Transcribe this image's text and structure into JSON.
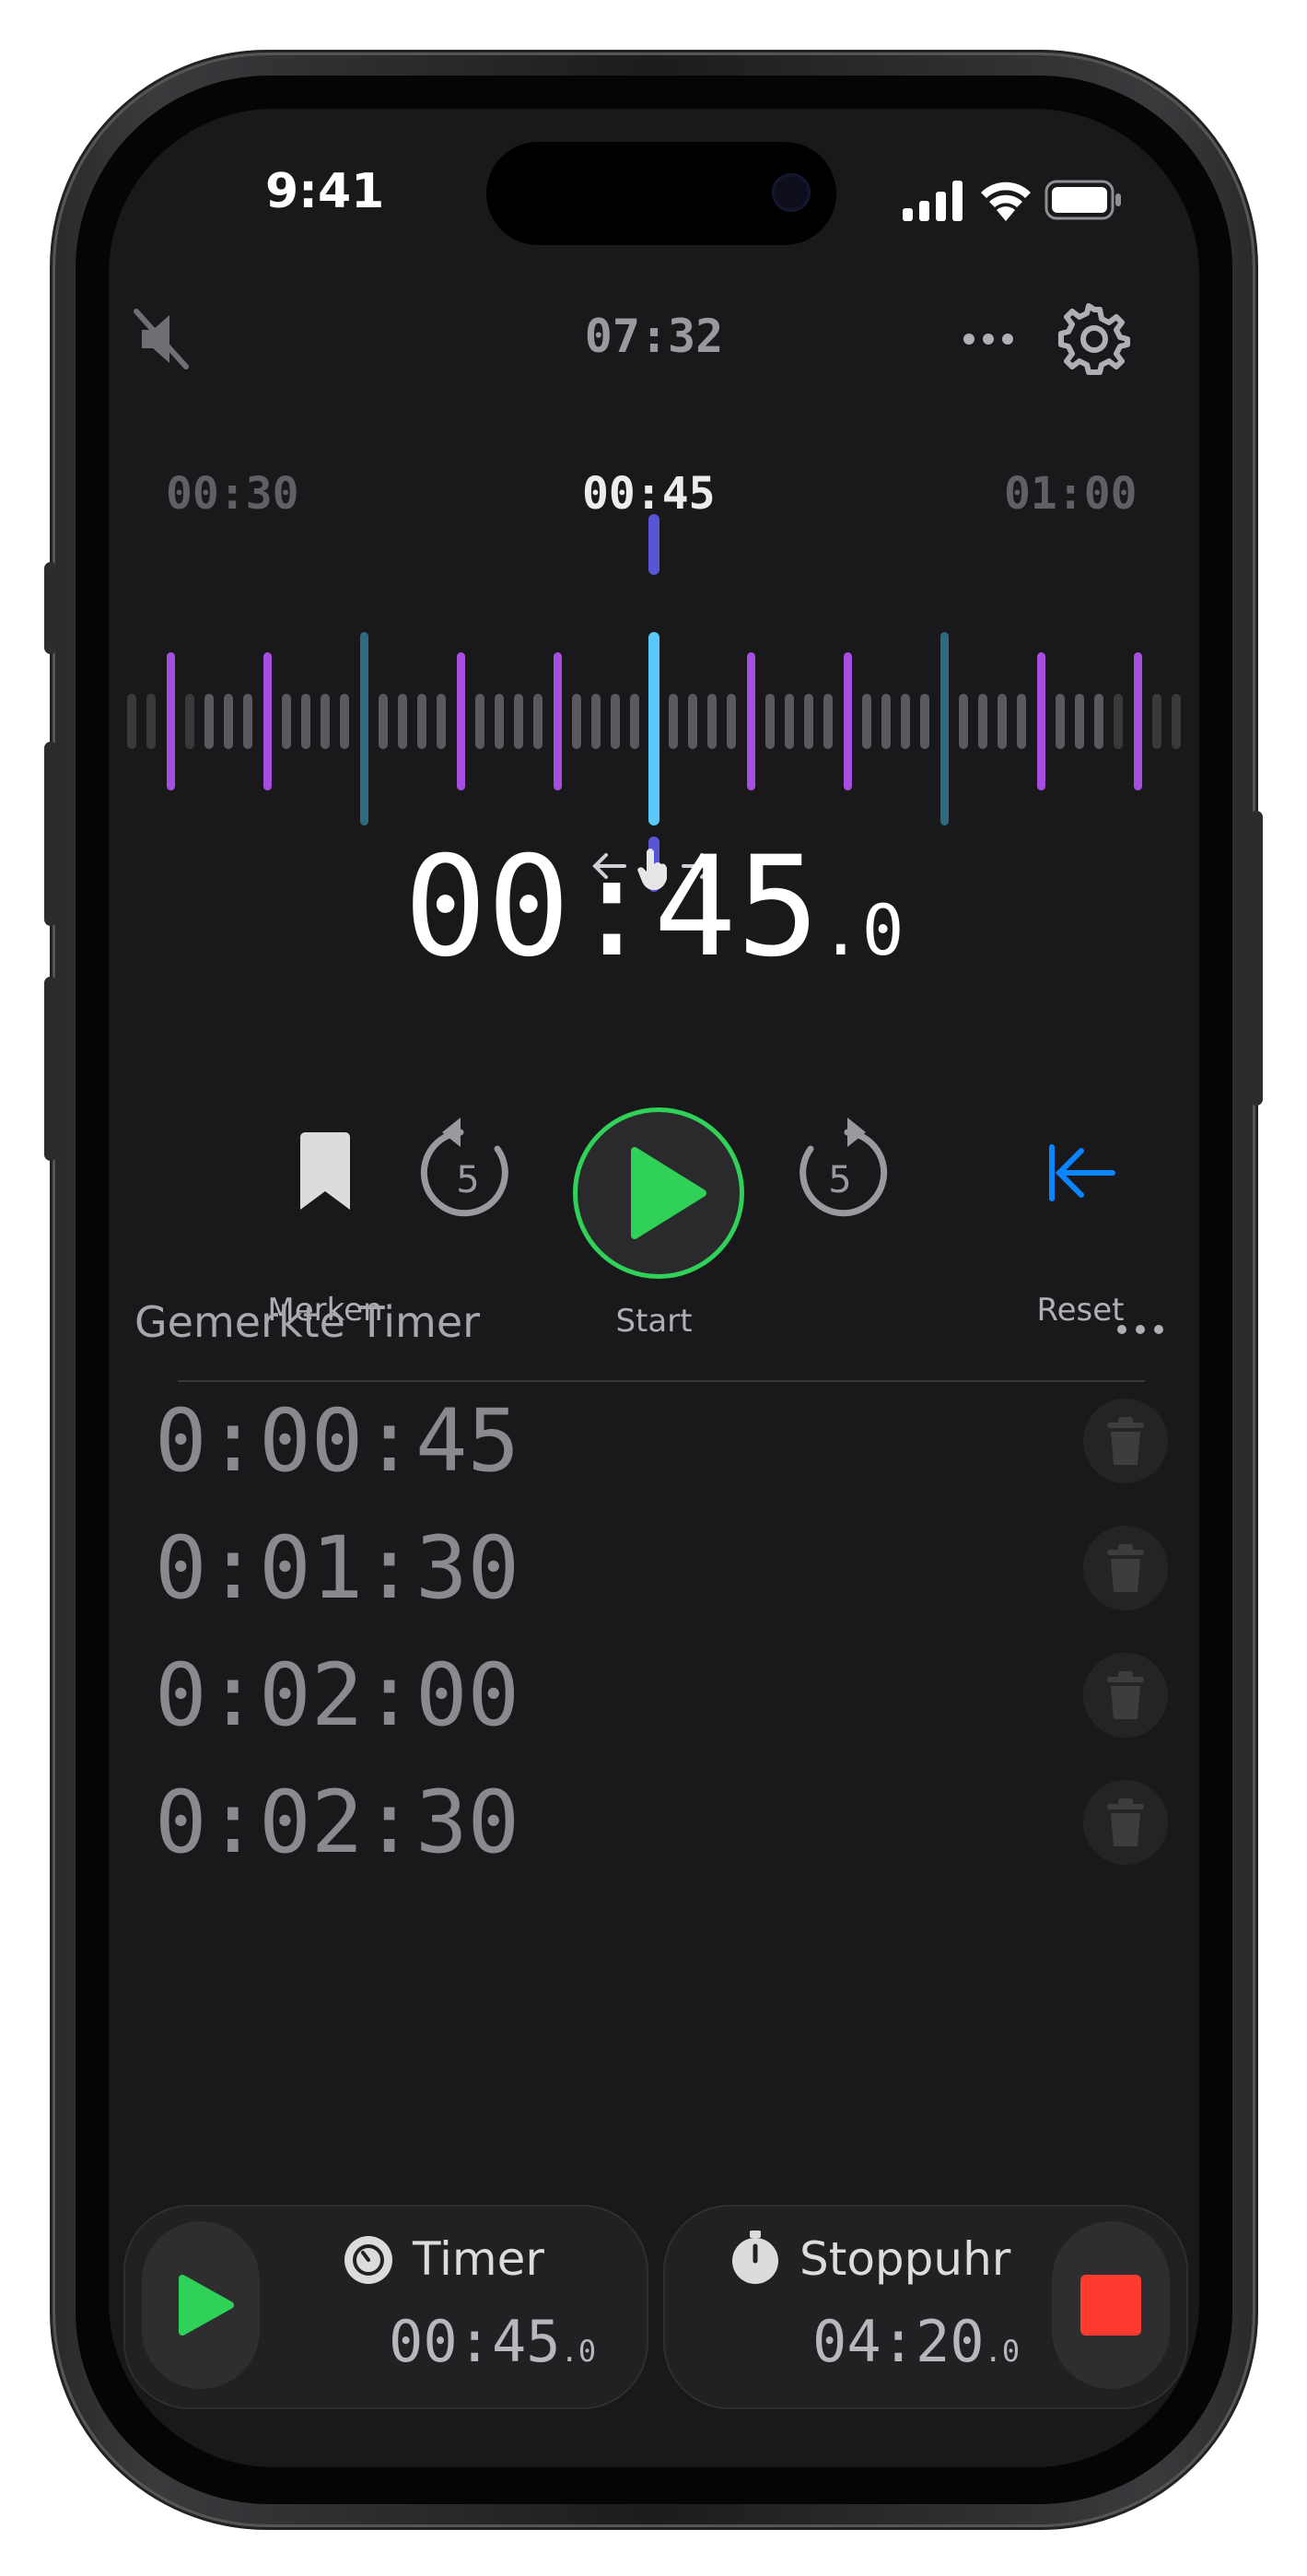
{
  "status_bar": {
    "time": "9:41"
  },
  "top_bar": {
    "clock": "07:32"
  },
  "ruler": {
    "left_label": "00:30",
    "center_label": "00:45",
    "right_label": "01:00"
  },
  "main_timer": {
    "time": "00:45",
    "fraction": ".0"
  },
  "controls": {
    "bookmark_label": "Merken",
    "back_seconds": "5",
    "start_label": "Start",
    "forward_seconds": "5",
    "reset_label": "Reset"
  },
  "saved": {
    "title": "Gemerkte Timer",
    "items": [
      "0:00:45",
      "0:01:30",
      "0:02:00",
      "0:02:30"
    ]
  },
  "cards": {
    "timer": {
      "title": "Timer",
      "time": "00:45",
      "fraction": ".0"
    },
    "stopwatch": {
      "title": "Stoppuhr",
      "time": "04:20",
      "fraction": ".0"
    }
  },
  "colors": {
    "accent_green": "#30d158",
    "accent_blue": "#0a84ff",
    "stop_red": "#ff3b30",
    "tick_purple": "#a64ee0",
    "tick_teal": "#2f6b80",
    "indicator_cyan": "#5ac8fa",
    "indicator_indigo": "#5856d6"
  },
  "icons": {
    "mute": "speaker-slash-icon",
    "more": "ellipsis-icon",
    "settings": "gear-icon",
    "bookmark": "bookmark-icon",
    "back": "rotate-back-icon",
    "play": "play-icon",
    "forward": "rotate-forward-icon",
    "reset": "arrow-left-to-line-icon",
    "trash": "trash-icon",
    "stop": "stop-icon"
  }
}
